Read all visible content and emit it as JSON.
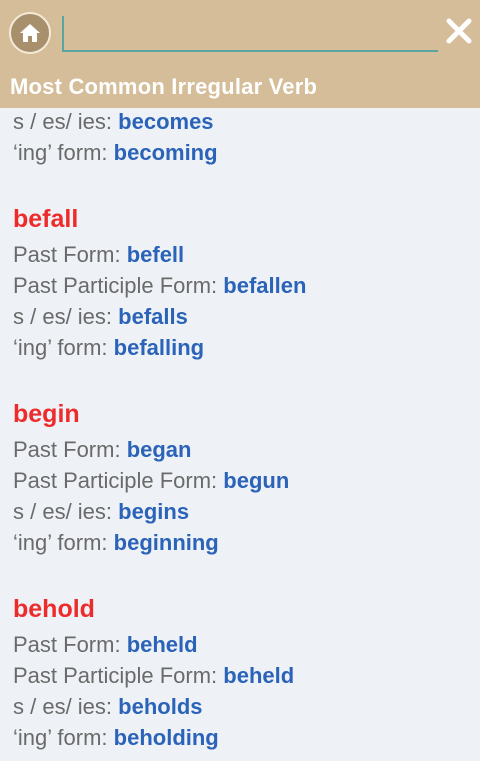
{
  "header": {
    "title": "Most Common Irregular Verb",
    "search_value": "",
    "search_placeholder": "",
    "home_icon": "home-icon",
    "close_icon": "close-icon",
    "colors": {
      "bar": "#d4bd98",
      "accent_line": "#5aa5a0"
    }
  },
  "partial_entry": {
    "s_label": "s / es/ ies: ",
    "s_value": "becomes",
    "ing_label": "‘ing’ form: ",
    "ing_value": "becoming"
  },
  "entries": [
    {
      "verb": "befall",
      "past_label": "Past Form: ",
      "past_value": "befell",
      "pp_label": "Past Participle Form: ",
      "pp_value": "befallen",
      "s_label": "s / es/ ies: ",
      "s_value": "befalls",
      "ing_label": "‘ing’ form: ",
      "ing_value": "befalling"
    },
    {
      "verb": "begin",
      "past_label": "Past Form: ",
      "past_value": "began",
      "pp_label": "Past Participle Form: ",
      "pp_value": "begun",
      "s_label": "s / es/ ies: ",
      "s_value": "begins",
      "ing_label": "‘ing’ form: ",
      "ing_value": "beginning"
    },
    {
      "verb": "behold",
      "past_label": "Past Form: ",
      "past_value": "beheld",
      "pp_label": "Past Participle Form: ",
      "pp_value": "beheld",
      "s_label": "s / es/ ies: ",
      "s_value": "beholds",
      "ing_label": "‘ing’ form: ",
      "ing_value": "beholding"
    }
  ],
  "colors": {
    "verb": "#ee2b2b",
    "label": "#6a6a6a",
    "value": "#2b63b8",
    "background": "#eef2f7"
  }
}
